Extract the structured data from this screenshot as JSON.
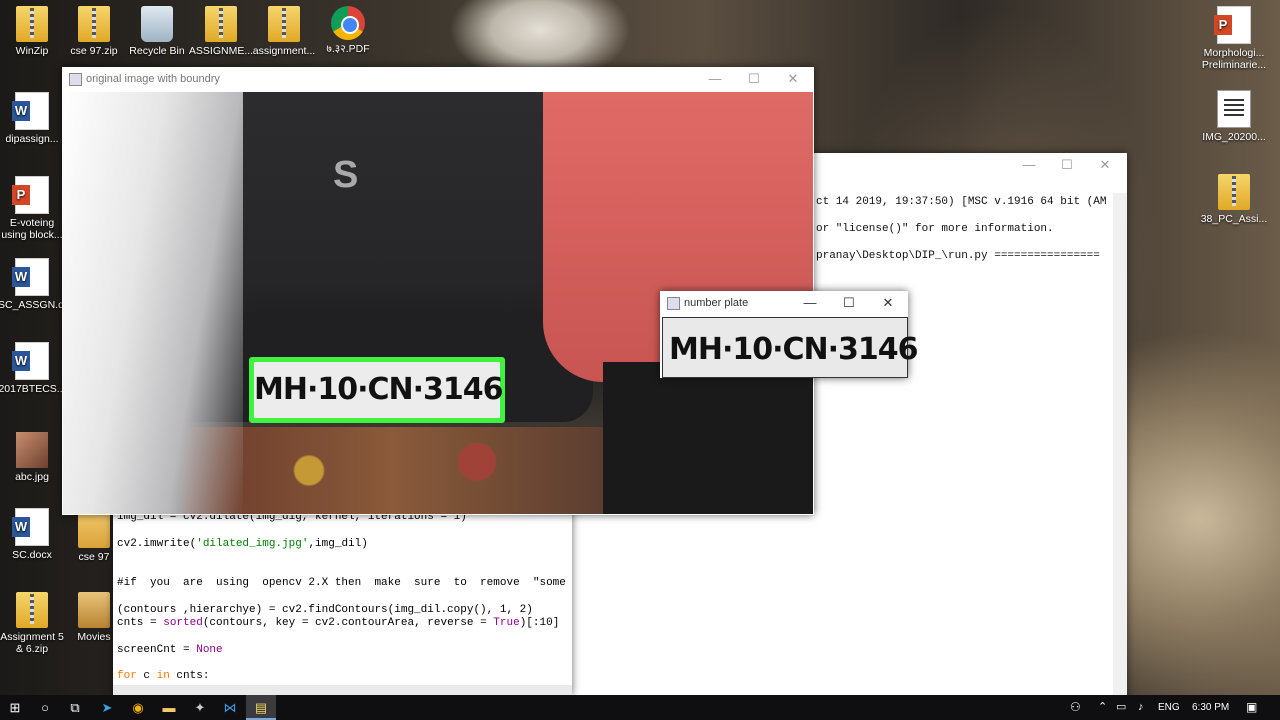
{
  "desktop": {
    "icons_left": [
      {
        "label": "WinZip",
        "icon": "winzip-icon"
      },
      {
        "label": "cse 97.zip",
        "icon": "zip-icon"
      },
      {
        "label": "Recycle Bin",
        "icon": "recycle-bin-icon"
      },
      {
        "label": "ASSIGNME...",
        "icon": "zip-icon"
      },
      {
        "label": "assignment...",
        "icon": "zip-icon"
      },
      {
        "label": "७.३२.PDF",
        "icon": "chrome-icon"
      },
      {
        "label": "dipassign...",
        "icon": "word-doc-icon"
      },
      {
        "label": "E-voteing using block...",
        "icon": "powerpoint-icon"
      },
      {
        "label": "SC_ASSGN.d...",
        "icon": "word-doc-icon"
      },
      {
        "label": "2017BTECS...",
        "icon": "word-doc-icon"
      },
      {
        "label": "abc.jpg",
        "icon": "image-file-icon"
      },
      {
        "label": "SC.docx",
        "icon": "word-doc-icon"
      },
      {
        "label": "cse 97",
        "icon": "folder-icon"
      },
      {
        "label": "Assignment 5 & 6.zip",
        "icon": "zip-icon"
      },
      {
        "label": "Movies",
        "icon": "folder-icon"
      }
    ],
    "icons_right": [
      {
        "label": "Morphologi... Preliminarie...",
        "icon": "powerpoint-icon"
      },
      {
        "label": "IMG_20200...",
        "icon": "text-doc-icon"
      },
      {
        "label": "38_PC_Assi...",
        "icon": "zip-icon"
      }
    ]
  },
  "shell_window": {
    "lines": [
      "ct 14 2019, 19:37:50) [MSC v.1916 64 bit (AM",
      "or \"license()\" for more information.",
      "pranay\\Desktop\\DIP_\\run.py ================"
    ]
  },
  "editor_window": {
    "line1": "img_dil = cv2.dilate(img_dig, kernel, iterations = 1)",
    "line2_a": "cv2.imwrite(",
    "line2_str": "'dilated_img.jpg'",
    "line2_b": ",img_dil)",
    "line3": "#if  you  are  using  opencv 2.X then  make  sure  to  remove  \"some",
    "line4": "(contours ,hierarchye) = cv2.findContours(img_dil.copy(), 1, 2)",
    "line5_a": "cnts = ",
    "line5_fn": "sorted",
    "line5_b": "(contours, key = cv2.contourArea, reverse = ",
    "line5_true": "True",
    "line5_c": ")[:10]",
    "line6_a": "screenCnt = ",
    "line6_none": "None",
    "line7_for": "for",
    "line7_b": " c ",
    "line7_in": "in",
    "line7_c": " cnts:"
  },
  "image_window": {
    "title": "original  image with boundry",
    "plate_text": "MH·10·CN·3146"
  },
  "plate_window": {
    "title": "number plate",
    "plate_text": "MH·10·CN·3146"
  },
  "window_controls": {
    "minimize": "—",
    "maximize": "☐",
    "close": "✕"
  },
  "taskbar": {
    "start_icon": "windows-start-icon",
    "apps": [
      "search-icon",
      "task-view-icon",
      "telegram-icon",
      "chrome-icon",
      "file-explorer-icon",
      "settings-app-icon",
      "vscode-icon",
      "python-idle-icon"
    ],
    "language": "ENG",
    "time": "6:30 PM",
    "notification_icon": "notification-icon"
  },
  "colors": {
    "plate_box": "#3ef23e",
    "shirt": "#d05c58",
    "taskbar": "#0f0f12"
  }
}
